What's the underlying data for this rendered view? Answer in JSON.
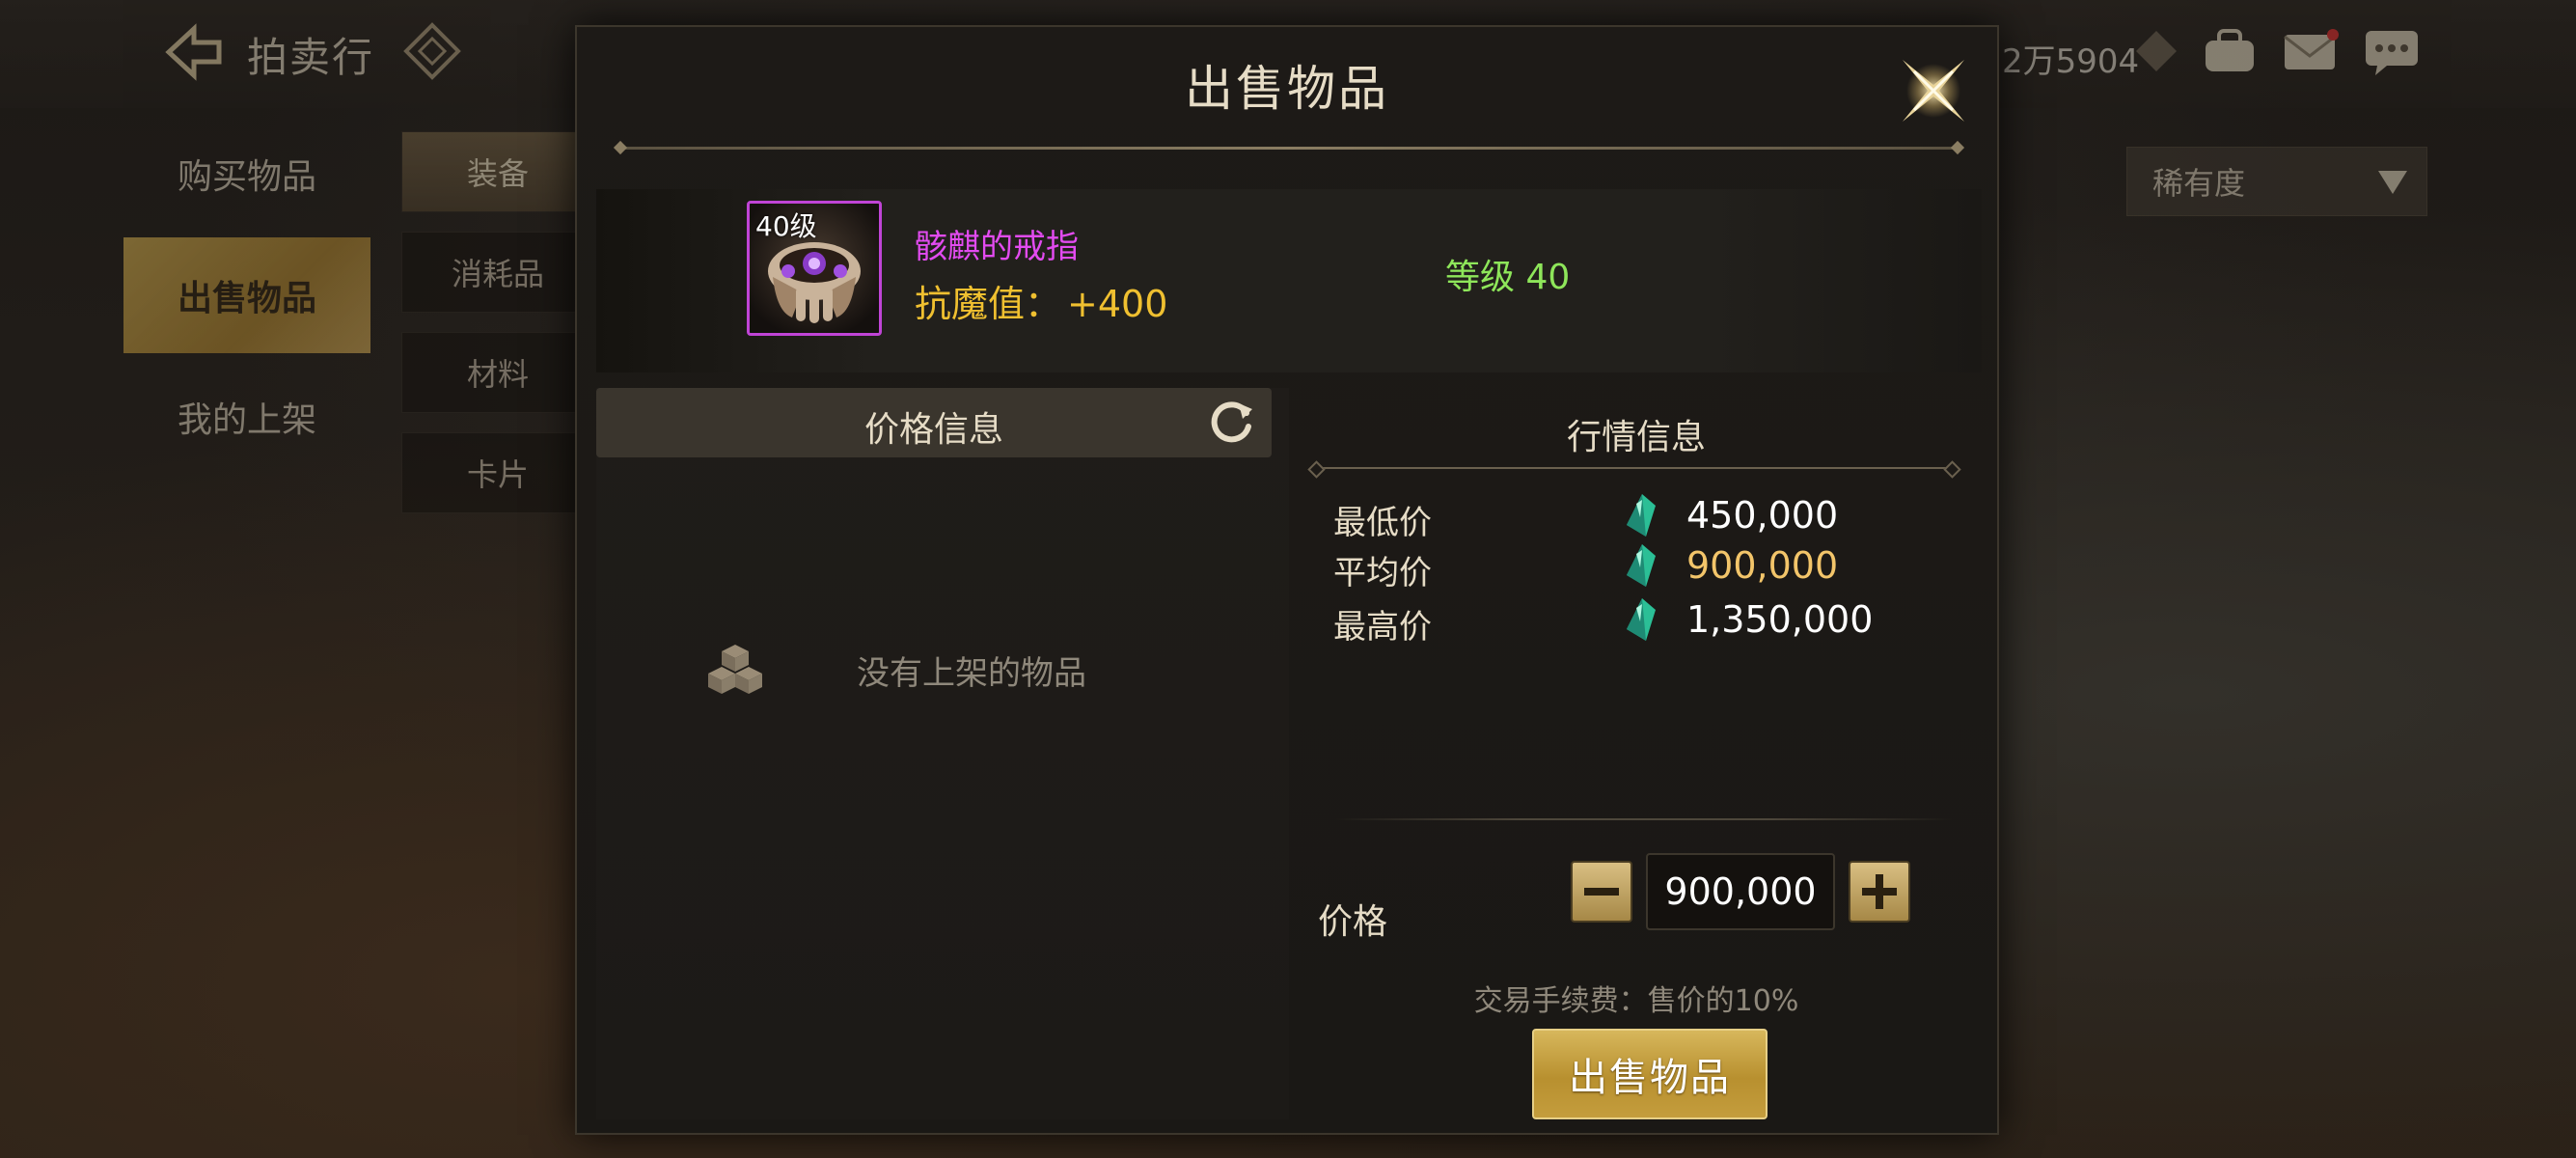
{
  "background": {
    "header": {
      "title": "拍卖行",
      "currency": "2万5904"
    },
    "sidebar": {
      "items": [
        {
          "label": "购买物品"
        },
        {
          "label": "出售物品"
        },
        {
          "label": "我的上架"
        }
      ]
    },
    "categories": {
      "items": [
        {
          "label": "装备"
        },
        {
          "label": "消耗品"
        },
        {
          "label": "材料"
        },
        {
          "label": "卡片"
        }
      ]
    },
    "sort": {
      "label": "稀有度"
    }
  },
  "modal": {
    "title": "出售物品",
    "item": {
      "level_tag": "40级",
      "name": "骸麒的戒指",
      "stat_label": "抗魔值：",
      "stat_value": "+400",
      "grade": "等级 40"
    },
    "price_info": {
      "title": "价格信息",
      "empty_text": "没有上架的物品"
    },
    "market_info": {
      "title": "行情信息",
      "rows": [
        {
          "label": "最低价",
          "value": "450,000"
        },
        {
          "label": "平均价",
          "value": "900,000"
        },
        {
          "label": "最高价",
          "value": "1,350,000"
        }
      ]
    },
    "price": {
      "label": "价格",
      "value": "900,000"
    },
    "fee_text": "交易手续费：售价的10%",
    "sell_button": "出售物品"
  },
  "colors": {
    "item_name": "#e24bf0",
    "stat": "#f0c030",
    "grade": "#8ee65a",
    "avg_price": "#f3c56a",
    "gold_button": "#c49d3d"
  }
}
